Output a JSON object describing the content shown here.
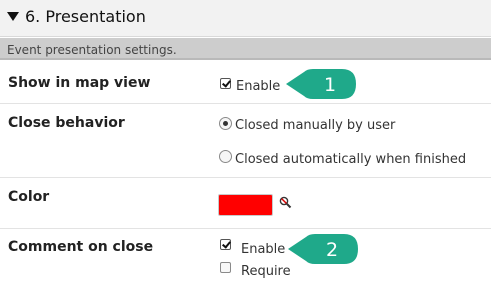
{
  "section": {
    "title": "6. Presentation",
    "description": "Event presentation settings."
  },
  "rows": {
    "map_view": {
      "label": "Show in map view",
      "enable_label": "Enable",
      "enable_checked": true
    },
    "close_behavior": {
      "label": "Close behavior",
      "options": [
        {
          "label": "Closed manually by user",
          "selected": true
        },
        {
          "label": "Closed automatically when finished",
          "selected": false
        }
      ]
    },
    "color": {
      "label": "Color",
      "value": "#ff0000"
    },
    "comment_on_close": {
      "label": "Comment on close",
      "enable_label": "Enable",
      "enable_checked": true,
      "require_label": "Require",
      "require_checked": false
    }
  },
  "callouts": [
    {
      "number": "1",
      "color": "#1fa98a"
    },
    {
      "number": "2",
      "color": "#1fa98a"
    }
  ]
}
